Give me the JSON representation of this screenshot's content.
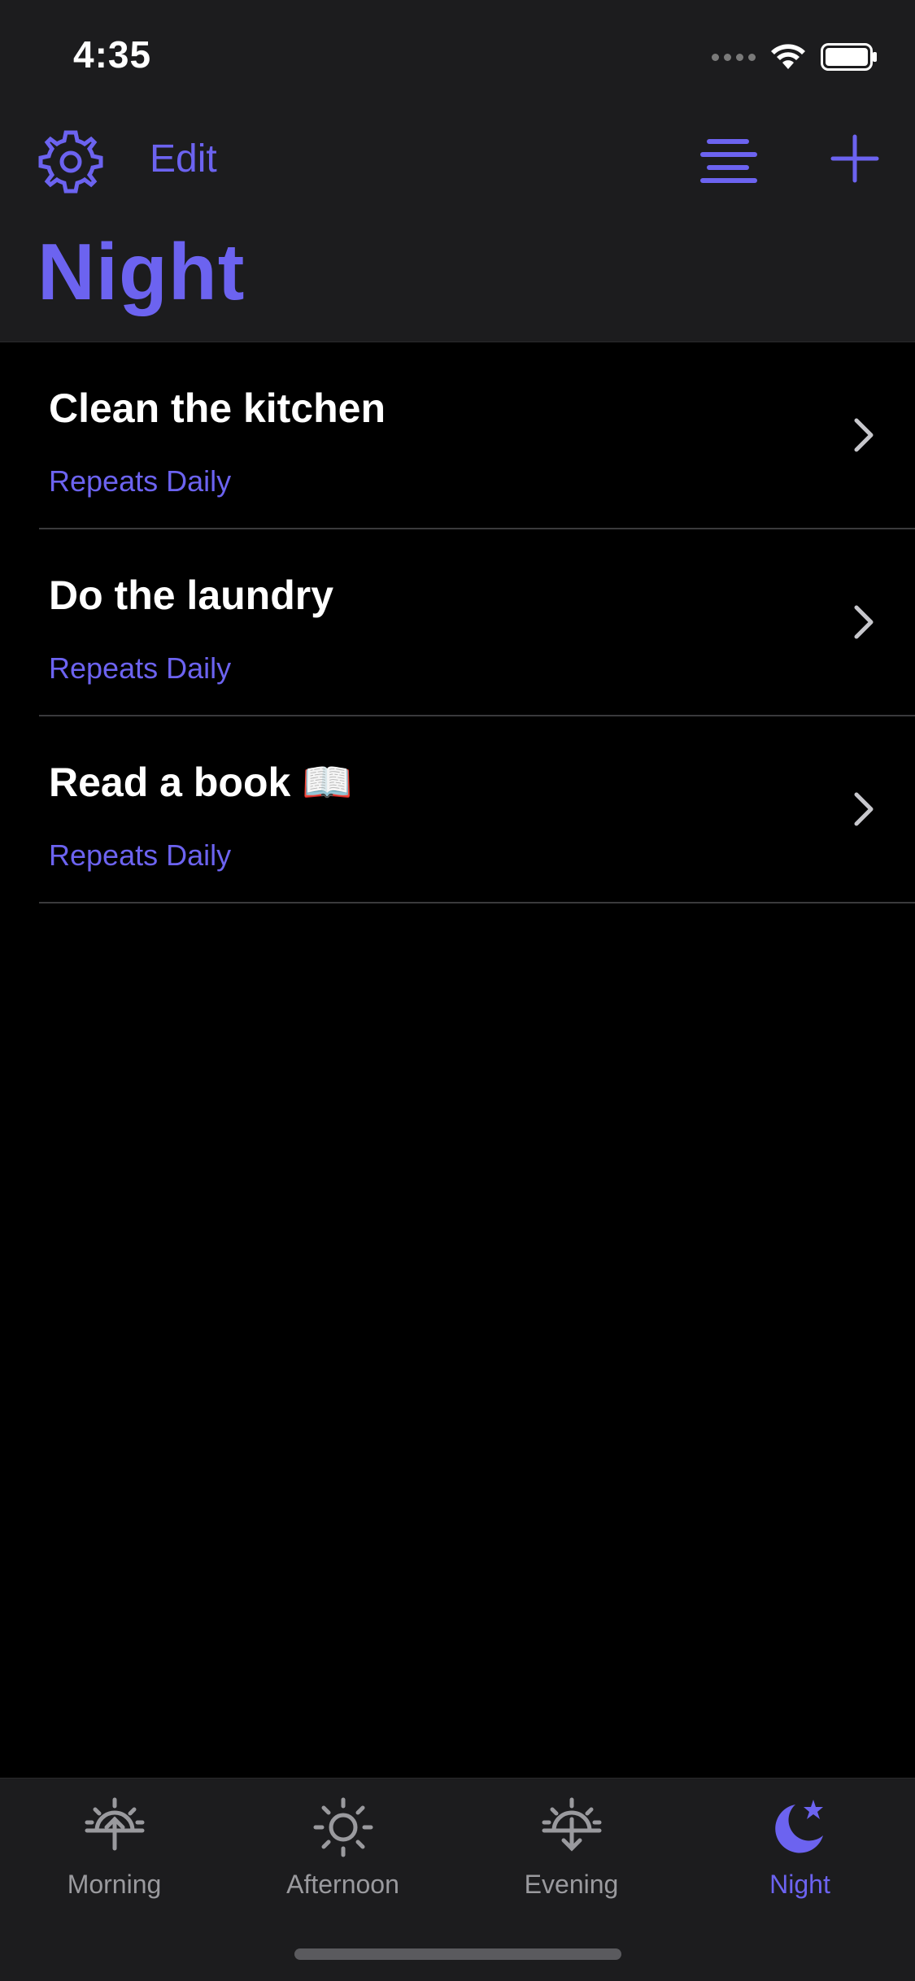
{
  "status_bar": {
    "time": "4:35"
  },
  "nav": {
    "edit_label": "Edit",
    "title": "Night",
    "icons": [
      "gear-icon",
      "list-icon",
      "plus-icon"
    ]
  },
  "tasks": [
    {
      "title": "Clean the kitchen",
      "subtitle": "Repeats Daily"
    },
    {
      "title": "Do the laundry",
      "subtitle": "Repeats Daily"
    },
    {
      "title": "Read a book 📖",
      "subtitle": "Repeats Daily"
    }
  ],
  "tabs": [
    {
      "label": "Morning",
      "icon": "sunrise-icon",
      "active": false
    },
    {
      "label": "Afternoon",
      "icon": "sun-icon",
      "active": false
    },
    {
      "label": "Evening",
      "icon": "sunset-icon",
      "active": false
    },
    {
      "label": "Night",
      "icon": "moon-star-icon",
      "active": true
    }
  ],
  "colors": {
    "accent": "#6c63f0",
    "background": "#000000",
    "bar_background": "#1c1c1e",
    "inactive_tab": "#9a9a9e"
  }
}
